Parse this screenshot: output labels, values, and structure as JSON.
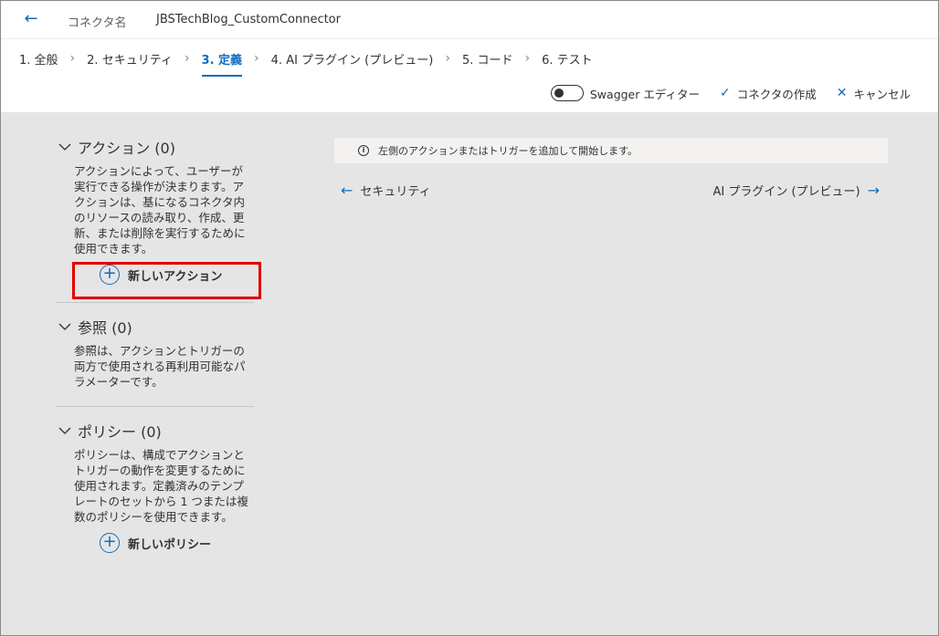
{
  "header": {
    "back_icon": "back-arrow-icon",
    "connector_label": "コネクタ名",
    "connector_name": "JBSTechBlog_CustomConnector"
  },
  "steps": [
    {
      "label": "1. 全般",
      "active": false
    },
    {
      "label": "2. セキュリティ",
      "active": false
    },
    {
      "label": "3. 定義",
      "active": true
    },
    {
      "label": "4. AI プラグイン (プレビュー)",
      "active": false
    },
    {
      "label": "5. コード",
      "active": false
    },
    {
      "label": "6. テスト",
      "active": false
    }
  ],
  "commands": {
    "swagger_label": "Swagger エディター",
    "create_label": "コネクタの作成",
    "cancel_label": "キャンセル"
  },
  "sections": {
    "actions": {
      "title": "アクション (0)",
      "description": "アクションによって、ユーザーが実行できる操作が決まります。アクションは、基になるコネクタ内のリソースの読み取り、作成、更新、または削除を実行するために使用できます。",
      "button": "新しいアクション"
    },
    "references": {
      "title": "参照 (0)",
      "description": "参照は、アクションとトリガーの両方で使用される再利用可能なパラメーターです。"
    },
    "policies": {
      "title": "ポリシー (0)",
      "description": "ポリシーは、構成でアクションとトリガーの動作を変更するために使用されます。定義済みのテンプレートのセットから 1 つまたは複数のポリシーを使用できます。",
      "button": "新しいポリシー"
    }
  },
  "info": {
    "message": "左側のアクションまたはトリガーを追加して開始します。"
  },
  "navigation": {
    "prev_label": "セキュリティ",
    "next_label": "AI プラグイン (プレビュー)"
  },
  "colors": {
    "accent": "#0f6cbd",
    "highlight": "#e00000",
    "content_bg": "#e5e5e5"
  }
}
